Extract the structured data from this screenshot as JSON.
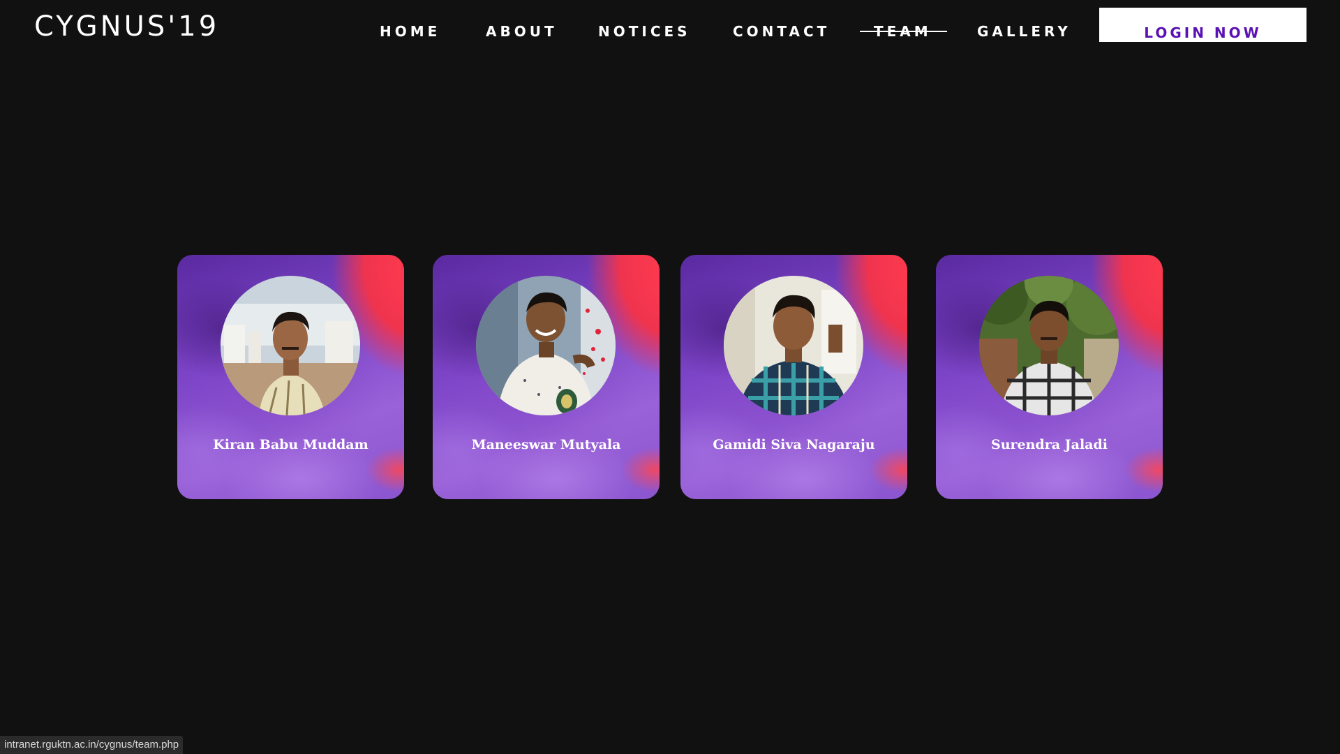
{
  "header": {
    "logo": "CYGNUS'19",
    "nav": [
      "HOME",
      "ABOUT",
      "NOTICES",
      "CONTACT",
      "TEAM",
      "GALLERY"
    ],
    "active_nav": "TEAM",
    "login_label": "LOGIN NOW"
  },
  "team": [
    {
      "name": "Kiran Babu Muddam"
    },
    {
      "name": "Maneeswar Mutyala"
    },
    {
      "name": "Gamidi Siva Nagaraju"
    },
    {
      "name": "Surendra Jaladi"
    }
  ],
  "status_bar": {
    "url": "intranet.rguktn.ac.in/cygnus/team.php"
  },
  "colors": {
    "background": "#111111",
    "login_text": "#5a12b5",
    "card_purple": "#7d45c8",
    "card_red": "#f0344e"
  }
}
